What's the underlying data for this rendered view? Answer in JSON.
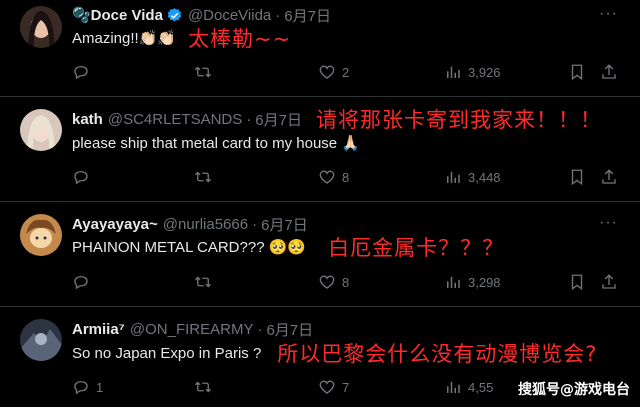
{
  "tweets": [
    {
      "name": "🫧Doce Vida",
      "handle": "@DoceViida",
      "date": "6月7日",
      "text": "Amazing!!👏🏻👏🏻",
      "translation": "太棒勒~~",
      "replies": "",
      "likes": "2",
      "views": "3,926",
      "verified": true
    },
    {
      "name": "kath",
      "handle": "@SC4RLETSANDS",
      "date": "6月7日",
      "text": "please ship that metal card to my house 🙏🏻",
      "translation": "请将那张卡寄到我家来！！！",
      "replies": "",
      "likes": "8",
      "views": "3,448",
      "verified": false
    },
    {
      "name": "Ayayayaya~",
      "handle": "@nurlia5666",
      "date": "6月7日",
      "text": "PHAINON METAL CARD??? 🥺🥺",
      "translation": "白厄金属卡？？？",
      "replies": "",
      "likes": "8",
      "views": "3,298",
      "verified": false
    },
    {
      "name": "Armiia⁷",
      "handle": "@ON_FIREARMY",
      "date": "6月7日",
      "text": "So no Japan Expo in Paris ?",
      "translation": "所以巴黎会什么没有动漫博览会?",
      "replies": "1",
      "likes": "7",
      "views": "4,55",
      "verified": false
    }
  ],
  "watermark": "搜狐号@游戏电台",
  "more_glyph": "···",
  "icons": [
    "reply-icon",
    "retweet-icon",
    "like-icon",
    "views-icon",
    "bookmark-icon",
    "share-icon",
    "verified-badge-icon",
    "more-icon"
  ],
  "colors": {
    "background": "#000000",
    "text": "#e7e9ea",
    "muted": "#71767b",
    "separator": "#2f3336",
    "annotation": "#ff2b2b",
    "verified": "#1d9bf0"
  }
}
